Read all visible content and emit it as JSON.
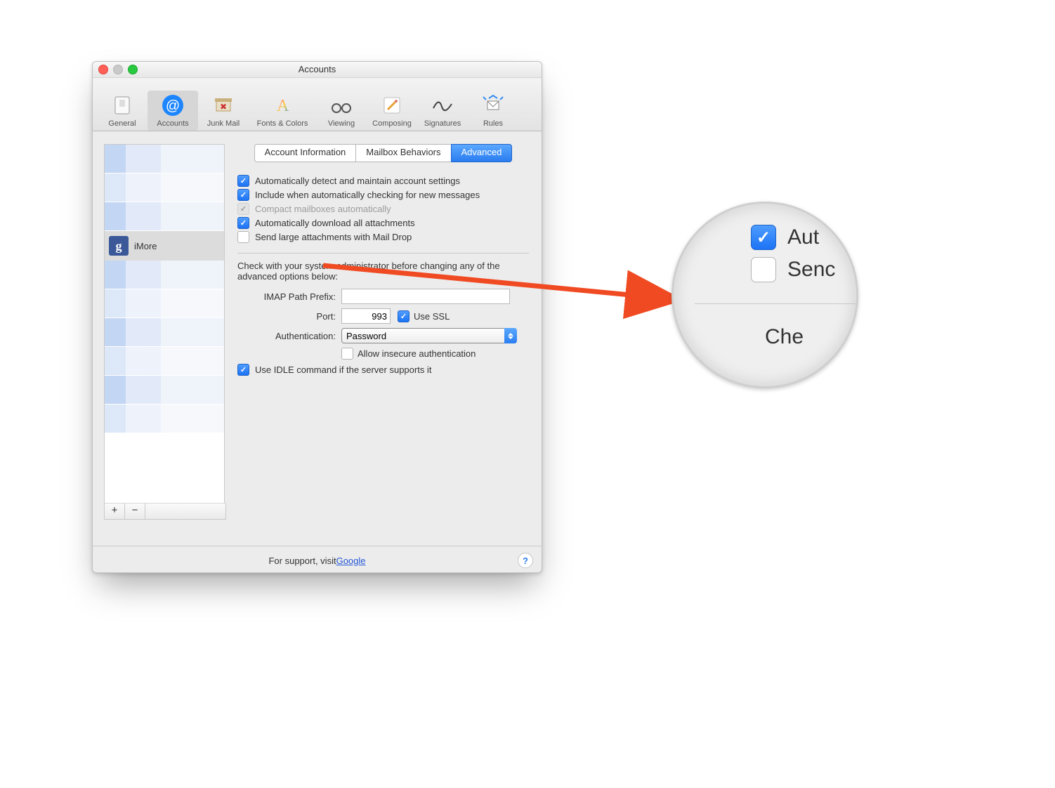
{
  "window": {
    "title": "Accounts"
  },
  "toolbar": [
    {
      "id": "general",
      "label": "General"
    },
    {
      "id": "accounts",
      "label": "Accounts",
      "selected": true
    },
    {
      "id": "junk",
      "label": "Junk Mail"
    },
    {
      "id": "fonts",
      "label": "Fonts & Colors",
      "wide": true
    },
    {
      "id": "viewing",
      "label": "Viewing"
    },
    {
      "id": "composing",
      "label": "Composing"
    },
    {
      "id": "sigs",
      "label": "Signatures"
    },
    {
      "id": "rules",
      "label": "Rules"
    }
  ],
  "sidebar": {
    "selected_account": "iMore",
    "add_glyph": "+",
    "remove_glyph": "−"
  },
  "subtabs": [
    {
      "id": "info",
      "label": "Account Information"
    },
    {
      "id": "mbox",
      "label": "Mailbox Behaviors"
    },
    {
      "id": "adv",
      "label": "Advanced",
      "active": true
    }
  ],
  "checks": {
    "autodetect": {
      "label": "Automatically detect and maintain account settings",
      "checked": true
    },
    "include_new": {
      "label": "Include when automatically checking for new messages",
      "checked": true
    },
    "compact": {
      "label": "Compact mailboxes automatically",
      "checked": true,
      "disabled": true
    },
    "autodl": {
      "label": "Automatically download all attachments",
      "checked": true
    },
    "maildrop": {
      "label": "Send large attachments with Mail Drop",
      "checked": false
    },
    "usessl": {
      "label": "Use SSL",
      "checked": true
    },
    "insecure": {
      "label": "Allow insecure authentication",
      "checked": false
    },
    "idle": {
      "label": "Use IDLE command if the server supports it",
      "checked": true
    }
  },
  "advanced": {
    "note": "Check with your system administrator before changing any of the advanced options below:",
    "imap_prefix_label": "IMAP Path Prefix:",
    "imap_prefix_value": "",
    "port_label": "Port:",
    "port_value": "993",
    "auth_label": "Authentication:",
    "auth_value": "Password"
  },
  "footer": {
    "prefix": "For support, visit ",
    "link_text": "Google",
    "help_glyph": "?"
  },
  "lens": {
    "line1_short": "Aut",
    "line2_short": "Senc",
    "line3_short": "Che"
  },
  "colors": {
    "accent": "#2a7df0",
    "arrow": "#f04a23"
  }
}
